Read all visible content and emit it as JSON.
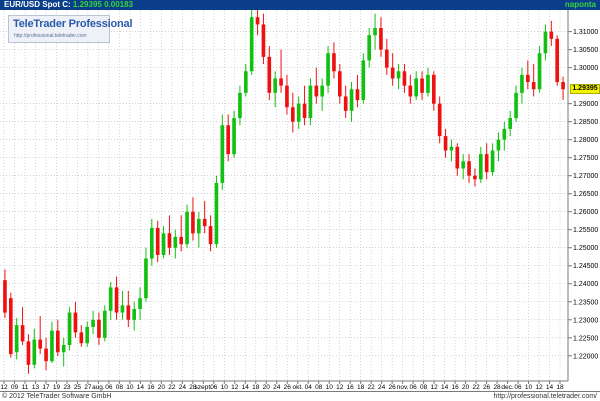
{
  "header": {
    "symbol": "EUR/USD Spot",
    "close_label": "C:",
    "close_value": "1.29395",
    "change": "0.00183",
    "period": "naponta"
  },
  "logo": {
    "brand": "TeleTrader Professional",
    "url": "http://professional.teletrader.com"
  },
  "footer": {
    "copyright": "© 2012 TeleTrader Software GmbH",
    "url": "http://professional.teletrader.com/"
  },
  "colors": {
    "up": "#11c011",
    "down": "#ee1111",
    "grid": "#b8b8b8",
    "header_bg": "#0a3e8a",
    "price_marker": "#f4f500"
  },
  "chart_data": {
    "type": "candlestick",
    "ylim": [
      1.213,
      1.316
    ],
    "y_ticks": [
      "1.22000",
      "1.22500",
      "1.23000",
      "1.23500",
      "1.24000",
      "1.24500",
      "1.25000",
      "1.25500",
      "1.26000",
      "1.26500",
      "1.27000",
      "1.27500",
      "1.28000",
      "1.28500",
      "1.29000",
      "1.29395",
      "1.30000",
      "1.30500",
      "1.31000"
    ],
    "x_tick_labels": [
      "12",
      "09",
      "11",
      "13",
      "17",
      "19",
      "23",
      "25",
      "27",
      "aug.",
      "06",
      "08",
      "10",
      "14",
      "16",
      "20",
      "22",
      "24",
      "28",
      "szept.",
      "06",
      "10",
      "12",
      "14",
      "18",
      "20",
      "24",
      "26",
      "okt.",
      "04",
      "08",
      "10",
      "12",
      "16",
      "18",
      "22",
      "24",
      "26",
      "nov.",
      "06",
      "08",
      "12",
      "14",
      "16",
      "20",
      "22",
      "26",
      "28",
      "dec.",
      "06",
      "10",
      "12",
      "14",
      "18"
    ],
    "last_price": "1.29395",
    "candles": [
      [
        1.241,
        1.244,
        1.2305,
        1.232
      ],
      [
        1.236,
        1.2375,
        1.2195,
        1.2205
      ],
      [
        1.221,
        1.2305,
        1.219,
        1.2285
      ],
      [
        1.2285,
        1.2335,
        1.223,
        1.224
      ],
      [
        1.224,
        1.226,
        1.215,
        1.2175
      ],
      [
        1.2175,
        1.2275,
        1.2165,
        1.2245
      ],
      [
        1.2245,
        1.231,
        1.2205,
        1.222
      ],
      [
        1.222,
        1.225,
        1.216,
        1.2185
      ],
      [
        1.2185,
        1.2295,
        1.218,
        1.227
      ],
      [
        1.227,
        1.23,
        1.22,
        1.221
      ],
      [
        1.221,
        1.225,
        1.217,
        1.223
      ],
      [
        1.223,
        1.2335,
        1.2215,
        1.232
      ],
      [
        1.232,
        1.235,
        1.225,
        1.2265
      ],
      [
        1.2265,
        1.2285,
        1.2225,
        1.2235
      ],
      [
        1.2235,
        1.2295,
        1.2225,
        1.228
      ],
      [
        1.228,
        1.2325,
        1.226,
        1.23
      ],
      [
        1.23,
        1.232,
        1.223,
        1.225
      ],
      [
        1.225,
        1.234,
        1.224,
        1.2325
      ],
      [
        1.2325,
        1.2405,
        1.23,
        1.239
      ],
      [
        1.239,
        1.242,
        1.23,
        1.232
      ],
      [
        1.232,
        1.238,
        1.23,
        1.234
      ],
      [
        1.234,
        1.238,
        1.228,
        1.23
      ],
      [
        1.23,
        1.235,
        1.227,
        1.233
      ],
      [
        1.233,
        1.239,
        1.23,
        1.236
      ],
      [
        1.236,
        1.25,
        1.235,
        1.247
      ],
      [
        1.247,
        1.258,
        1.245,
        1.2555
      ],
      [
        1.2555,
        1.2575,
        1.246,
        1.248
      ],
      [
        1.248,
        1.256,
        1.247,
        1.254
      ],
      [
        1.254,
        1.259,
        1.248,
        1.25
      ],
      [
        1.25,
        1.255,
        1.247,
        1.253
      ],
      [
        1.253,
        1.259,
        1.249,
        1.251
      ],
      [
        1.251,
        1.262,
        1.25,
        1.26
      ],
      [
        1.26,
        1.264,
        1.252,
        1.254
      ],
      [
        1.254,
        1.26,
        1.25,
        1.258
      ],
      [
        1.258,
        1.263,
        1.254,
        1.256
      ],
      [
        1.256,
        1.259,
        1.249,
        1.251
      ],
      [
        1.251,
        1.27,
        1.25,
        1.268
      ],
      [
        1.268,
        1.287,
        1.266,
        1.284
      ],
      [
        1.284,
        1.287,
        1.274,
        1.276
      ],
      [
        1.276,
        1.288,
        1.275,
        1.286
      ],
      [
        1.286,
        1.295,
        1.284,
        1.293
      ],
      [
        1.293,
        1.301,
        1.292,
        1.299
      ],
      [
        1.299,
        1.316,
        1.298,
        1.314
      ],
      [
        1.314,
        1.317,
        1.309,
        1.312
      ],
      [
        1.312,
        1.315,
        1.301,
        1.303
      ],
      [
        1.303,
        1.306,
        1.291,
        1.293
      ],
      [
        1.293,
        1.299,
        1.289,
        1.297
      ],
      [
        1.297,
        1.305,
        1.293,
        1.295
      ],
      [
        1.295,
        1.298,
        1.287,
        1.289
      ],
      [
        1.289,
        1.293,
        1.282,
        1.285
      ],
      [
        1.285,
        1.292,
        1.283,
        1.29
      ],
      [
        1.29,
        1.295,
        1.284,
        1.286
      ],
      [
        1.286,
        1.297,
        1.284,
        1.295
      ],
      [
        1.295,
        1.3,
        1.29,
        1.292
      ],
      [
        1.292,
        1.297,
        1.288,
        1.295
      ],
      [
        1.295,
        1.306,
        1.293,
        1.304
      ],
      [
        1.304,
        1.307,
        1.297,
        1.299
      ],
      [
        1.299,
        1.301,
        1.29,
        1.292
      ],
      [
        1.292,
        1.295,
        1.286,
        1.288
      ],
      [
        1.288,
        1.296,
        1.285,
        1.294
      ],
      [
        1.294,
        1.298,
        1.289,
        1.291
      ],
      [
        1.291,
        1.304,
        1.29,
        1.302
      ],
      [
        1.302,
        1.311,
        1.3,
        1.309
      ],
      [
        1.309,
        1.315,
        1.305,
        1.311
      ],
      [
        1.311,
        1.314,
        1.303,
        1.305
      ],
      [
        1.305,
        1.308,
        1.298,
        1.3
      ],
      [
        1.3,
        1.304,
        1.295,
        1.297
      ],
      [
        1.297,
        1.301,
        1.294,
        1.299
      ],
      [
        1.299,
        1.301,
        1.293,
        1.295
      ],
      [
        1.295,
        1.298,
        1.29,
        1.292
      ],
      [
        1.292,
        1.299,
        1.291,
        1.297
      ],
      [
        1.297,
        1.299,
        1.291,
        1.293
      ],
      [
        1.293,
        1.3,
        1.292,
        1.298
      ],
      [
        1.298,
        1.299,
        1.288,
        1.29
      ],
      [
        1.29,
        1.292,
        1.279,
        1.281
      ],
      [
        1.281,
        1.283,
        1.275,
        1.277
      ],
      [
        1.277,
        1.28,
        1.274,
        1.278
      ],
      [
        1.278,
        1.279,
        1.27,
        1.272
      ],
      [
        1.272,
        1.276,
        1.269,
        1.274
      ],
      [
        1.274,
        1.276,
        1.268,
        1.27
      ],
      [
        1.27,
        1.272,
        1.267,
        1.269
      ],
      [
        1.269,
        1.278,
        1.268,
        1.276
      ],
      [
        1.276,
        1.279,
        1.269,
        1.271
      ],
      [
        1.271,
        1.279,
        1.27,
        1.277
      ],
      [
        1.277,
        1.282,
        1.274,
        1.28
      ],
      [
        1.28,
        1.285,
        1.277,
        1.283
      ],
      [
        1.283,
        1.288,
        1.281,
        1.286
      ],
      [
        1.286,
        1.295,
        1.285,
        1.293
      ],
      [
        1.293,
        1.3,
        1.29,
        1.298
      ],
      [
        1.298,
        1.302,
        1.294,
        1.296
      ],
      [
        1.296,
        1.301,
        1.292,
        1.294
      ],
      [
        1.294,
        1.306,
        1.293,
        1.304
      ],
      [
        1.304,
        1.312,
        1.302,
        1.31
      ],
      [
        1.31,
        1.313,
        1.306,
        1.308
      ],
      [
        1.308,
        1.309,
        1.295,
        1.296
      ],
      [
        1.296,
        1.2975,
        1.291,
        1.294
      ]
    ]
  }
}
